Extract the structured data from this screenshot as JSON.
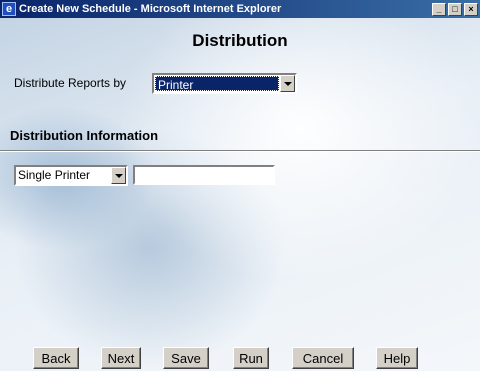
{
  "window": {
    "title": "Create New Schedule - Microsoft Internet Explorer",
    "icon": "ie-icon",
    "controls": [
      "minimize-icon",
      "maximize-icon",
      "close-icon"
    ]
  },
  "page": {
    "heading": "Distribution"
  },
  "distribute_by": {
    "label": "Distribute Reports by",
    "selected": "Printer"
  },
  "distribution_info": {
    "title": "Distribution Information",
    "printer_mode_selected": "Single Printer",
    "printer_name_value": ""
  },
  "buttons": {
    "back": "Back",
    "next": "Next",
    "save": "Save",
    "run": "Run",
    "cancel": "Cancel",
    "help": "Help"
  }
}
